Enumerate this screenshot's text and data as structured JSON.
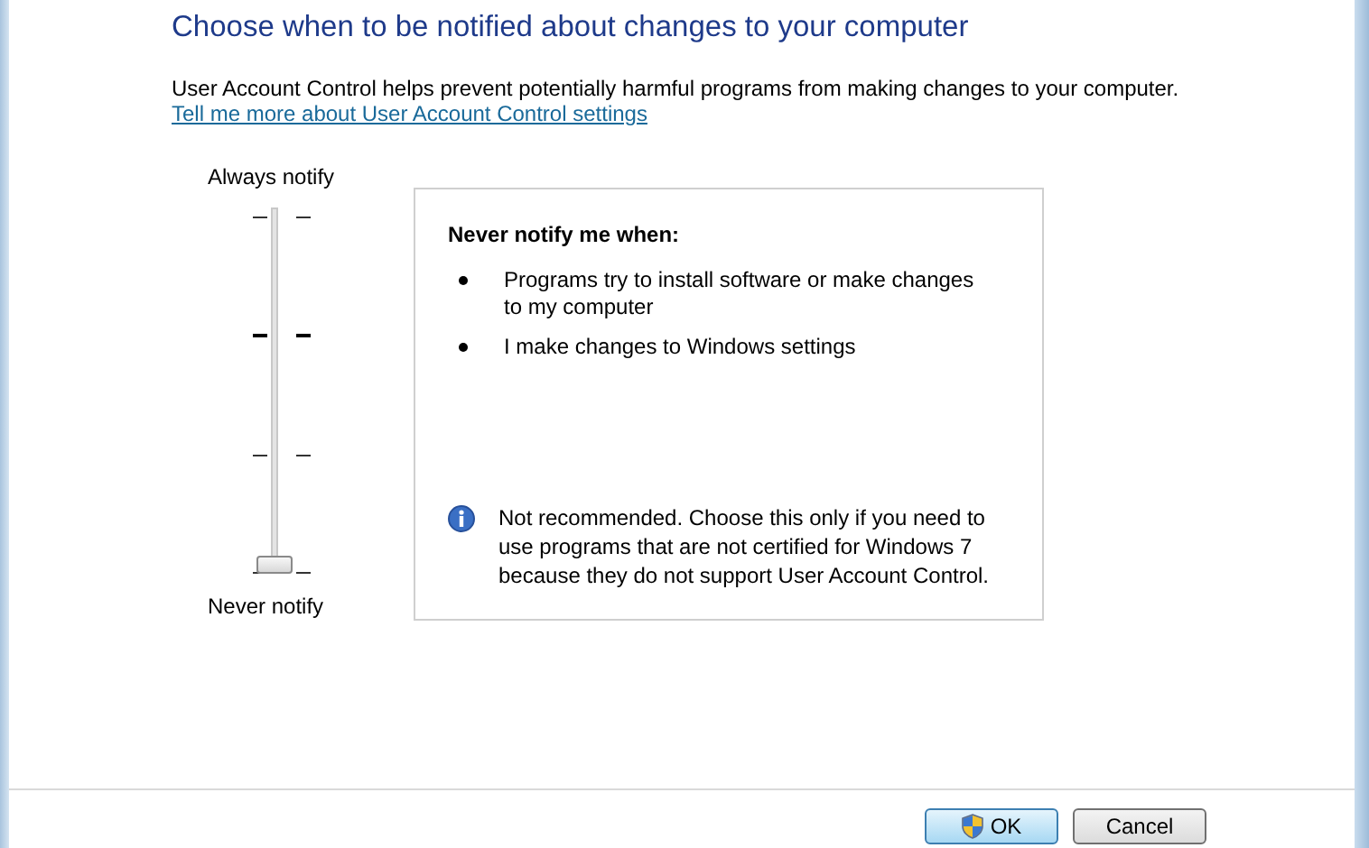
{
  "heading": "Choose when to be notified about changes to your computer",
  "description": "User Account Control helps prevent potentially harmful programs from making changes to your computer.",
  "link": "Tell me more about User Account Control settings",
  "slider": {
    "top_label": "Always notify",
    "bottom_label": "Never notify",
    "level": 0
  },
  "info_box": {
    "title": "Never notify me when:",
    "bullets": [
      "Programs try to install software or make changes to my computer",
      "I make changes to Windows settings"
    ],
    "note": "Not recommended. Choose this only if you need to use programs that are not certified for Windows 7 because they do not support User Account Control."
  },
  "buttons": [
    {
      "label": "OK",
      "kind": "shield",
      "default": true
    },
    {
      "label": "Cancel",
      "kind": "plain",
      "default": false
    }
  ]
}
